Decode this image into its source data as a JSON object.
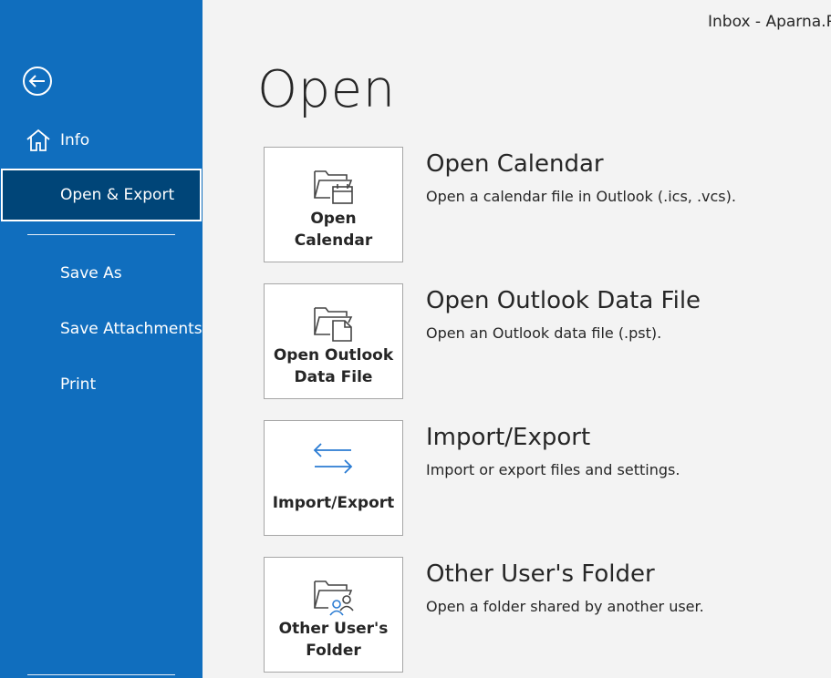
{
  "window": {
    "title": "Inbox - Aparna.Pa"
  },
  "sidebar": {
    "items": [
      {
        "label": "Info",
        "icon": "home-icon"
      },
      {
        "label": "Open & Export",
        "selected": true
      },
      {
        "label": "Save As"
      },
      {
        "label": "Save Attachments"
      },
      {
        "label": "Print"
      }
    ]
  },
  "main": {
    "title": "Open",
    "options": [
      {
        "tile_line1": "Open",
        "tile_line2": "Calendar",
        "heading": "Open Calendar",
        "description": "Open a calendar file in Outlook (.ics, .vcs).",
        "icon": "calendar-folder-icon"
      },
      {
        "tile_line1": "Open Outlook",
        "tile_line2": "Data File",
        "heading": "Open Outlook Data File",
        "description": "Open an Outlook data file (.pst).",
        "icon": "data-file-folder-icon"
      },
      {
        "tile_line1": "Import/Export",
        "heading": "Import/Export",
        "description": "Import or export files and settings.",
        "icon": "import-export-arrows-icon"
      },
      {
        "tile_line1": "Other User's",
        "tile_line2": "Folder",
        "heading": "Other User's Folder",
        "description": "Open a folder shared by another user.",
        "icon": "shared-folder-users-icon"
      }
    ]
  },
  "colors": {
    "sidebar_bg": "#106ebe",
    "selected_bg": "#004578",
    "accent": "#0f6cbd",
    "page_bg": "#f3f3f3"
  }
}
